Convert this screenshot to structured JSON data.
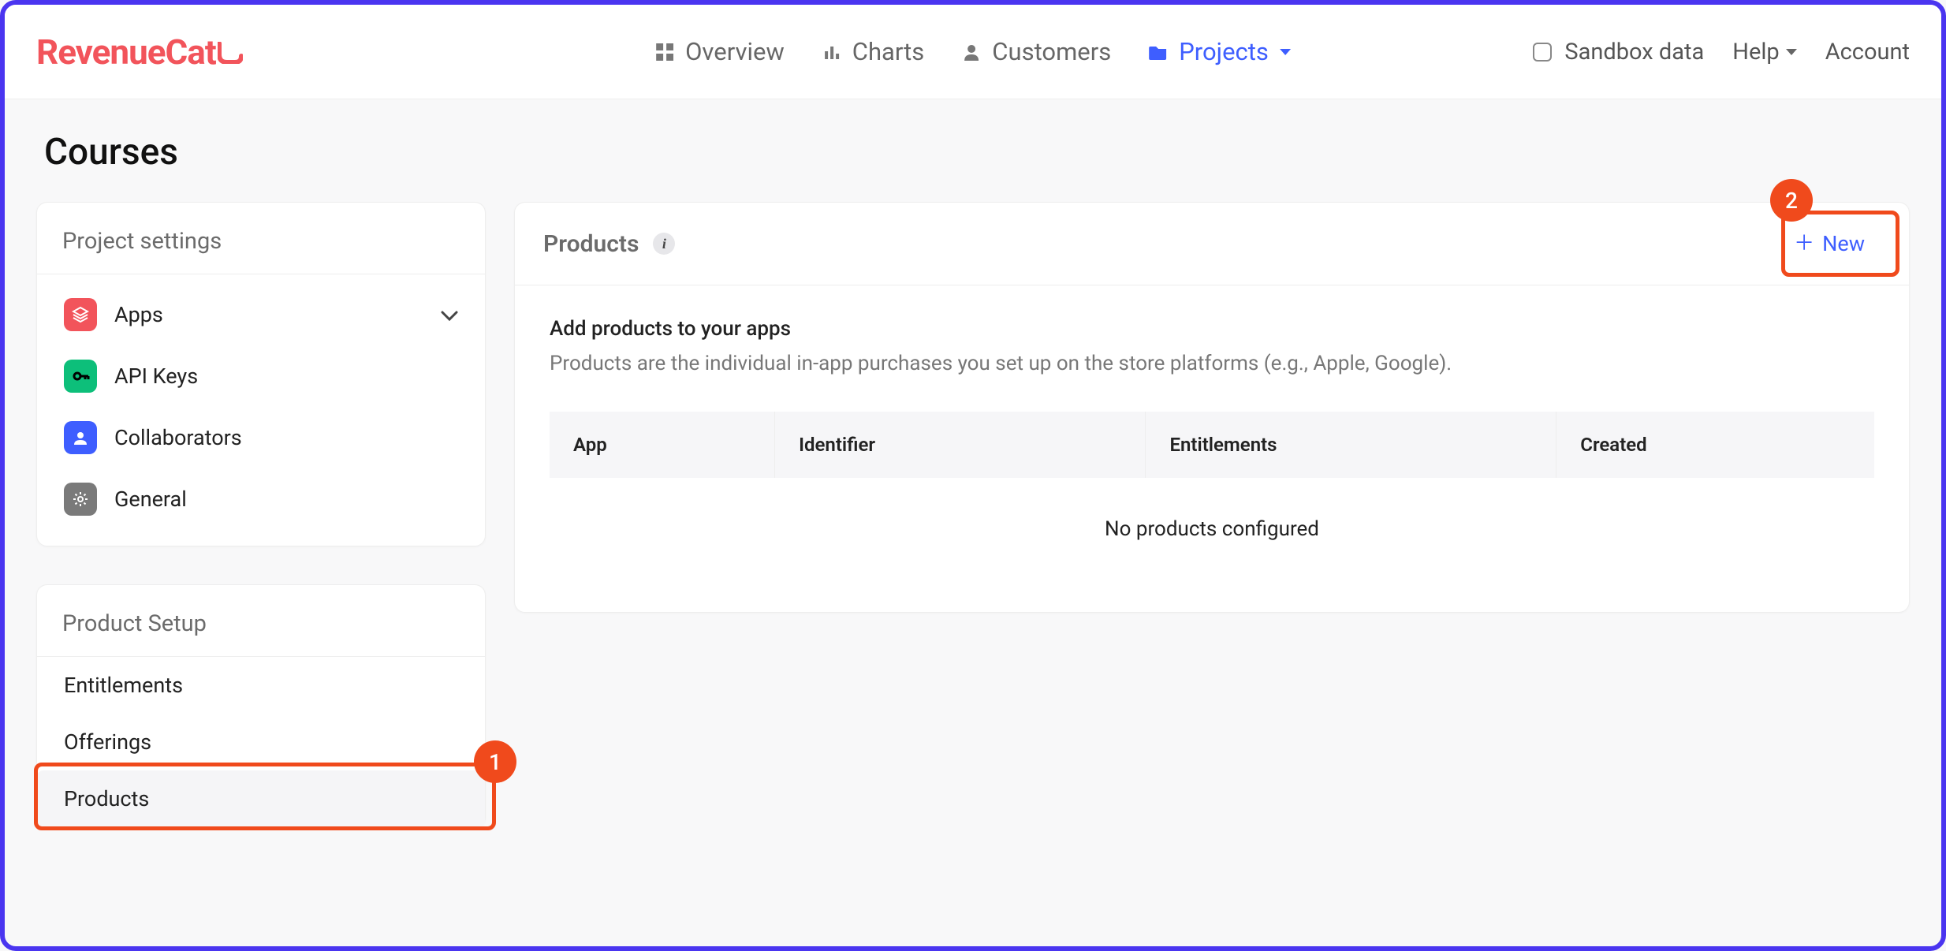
{
  "brand": "RevenueCat",
  "nav": {
    "overview": "Overview",
    "charts": "Charts",
    "customers": "Customers",
    "projects": "Projects"
  },
  "right": {
    "sandbox": "Sandbox data",
    "help": "Help",
    "account": "Account"
  },
  "page_title": "Courses",
  "sidebar": {
    "project_settings_title": "Project settings",
    "items": [
      {
        "label": "Apps"
      },
      {
        "label": "API Keys"
      },
      {
        "label": "Collaborators"
      },
      {
        "label": "General"
      }
    ],
    "product_setup_title": "Product Setup",
    "setup_items": [
      {
        "label": "Entitlements"
      },
      {
        "label": "Offerings"
      },
      {
        "label": "Products"
      }
    ]
  },
  "panel": {
    "title": "Products",
    "new_label": "New",
    "body_title": "Add products to your apps",
    "body_desc": "Products are the individual in-app purchases you set up on the store platforms (e.g., Apple, Google).",
    "columns": {
      "app": "App",
      "identifier": "Identifier",
      "entitlements": "Entitlements",
      "created": "Created"
    },
    "empty": "No products configured"
  },
  "annotations": {
    "one": "1",
    "two": "2"
  }
}
